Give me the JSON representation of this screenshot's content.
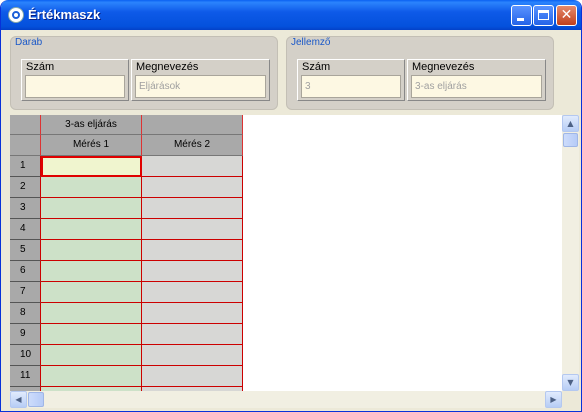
{
  "window": {
    "title": "Értékmaszk"
  },
  "darab": {
    "title": "Darab",
    "szam_label": "Szám",
    "szam_value": "",
    "megnevezes_label": "Megnevezés",
    "megnevezes_value": "Eljárások"
  },
  "jellemzo": {
    "title": "Jellemző",
    "szam_label": "Szám",
    "szam_value": "3",
    "megnevezes_label": "Megnevezés",
    "megnevezes_value": "3-as eljárás"
  },
  "grid": {
    "group_header": "3-as eljárás",
    "columns": [
      "Mérés 1",
      "Mérés 2"
    ],
    "rows": [
      "1",
      "2",
      "3",
      "4",
      "5",
      "6",
      "7",
      "8",
      "9",
      "10",
      "11"
    ]
  }
}
